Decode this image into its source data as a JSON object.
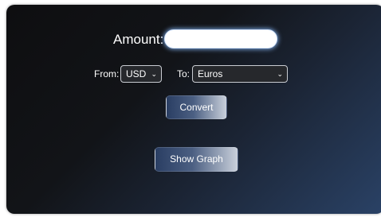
{
  "amount": {
    "label": "Amount:",
    "value": "",
    "placeholder": ""
  },
  "currency": {
    "from_label": "From:",
    "from_selected": "USD",
    "to_label": "To:",
    "to_selected": "Euros"
  },
  "buttons": {
    "convert": "Convert",
    "show_graph": "Show Graph"
  },
  "icons": {
    "dropdown": "chevron-down-icon"
  },
  "colors": {
    "panel_dark": "#0e0e10",
    "panel_accent": "#2a4266",
    "input_glow": "#8cbeff"
  }
}
